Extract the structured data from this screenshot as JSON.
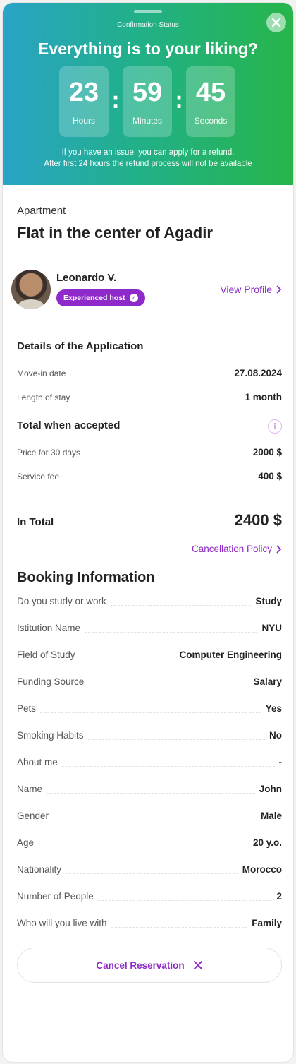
{
  "header": {
    "status_label": "Confirmation Status",
    "title": "Everything is to your liking?",
    "timer": {
      "hours": "23",
      "hours_label": "Hours",
      "minutes": "59",
      "minutes_label": "Minutes",
      "seconds": "45",
      "seconds_label": "Seconds",
      "separator": ":"
    },
    "note_line1": "If you have an issue, you can apply for a refund.",
    "note_line2": "After first 24 hours the refund process will not be available"
  },
  "listing": {
    "type": "Apartment",
    "title": "Flat in the center of Agadir"
  },
  "host": {
    "name": "Leonardo V.",
    "badge": "Experienced host",
    "view_profile": "View Profile"
  },
  "application": {
    "title": "Details of the Application",
    "move_in_label": "Move-in date",
    "move_in_value": "27.08.2024",
    "stay_label": "Length of stay",
    "stay_value": "1 month"
  },
  "pricing": {
    "title": "Total when accepted",
    "price_label": "Price for 30 days",
    "price_value": "2000 $",
    "fee_label": "Service fee",
    "fee_value": "400 $",
    "total_label": "In Total",
    "total_value": "2400 $",
    "policy_link": "Cancellation Policy"
  },
  "booking": {
    "title": "Booking Information",
    "rows": [
      {
        "label": "Do you study or work",
        "value": "Study"
      },
      {
        "label": "Istitution Name",
        "value": "NYU"
      },
      {
        "label": "Field of Study",
        "value": "Computer Engineering"
      },
      {
        "label": "Funding Source",
        "value": "Salary"
      },
      {
        "label": "Pets",
        "value": "Yes"
      },
      {
        "label": "Smoking Habits",
        "value": "No"
      },
      {
        "label": "About me",
        "value": "-"
      },
      {
        "label": "Name",
        "value": "John"
      },
      {
        "label": "Gender",
        "value": "Male"
      },
      {
        "label": "Age",
        "value": "20 y.o."
      },
      {
        "label": "Nationality",
        "value": "Morocco"
      },
      {
        "label": "Number of People",
        "value": "2"
      },
      {
        "label": "Who will you live with",
        "value": "Family"
      }
    ]
  },
  "actions": {
    "cancel_label": "Cancel Reservation"
  },
  "colors": {
    "accent": "#8e2ac9",
    "header_gradient_start": "#2aa3c7",
    "header_gradient_end": "#27b54a"
  }
}
